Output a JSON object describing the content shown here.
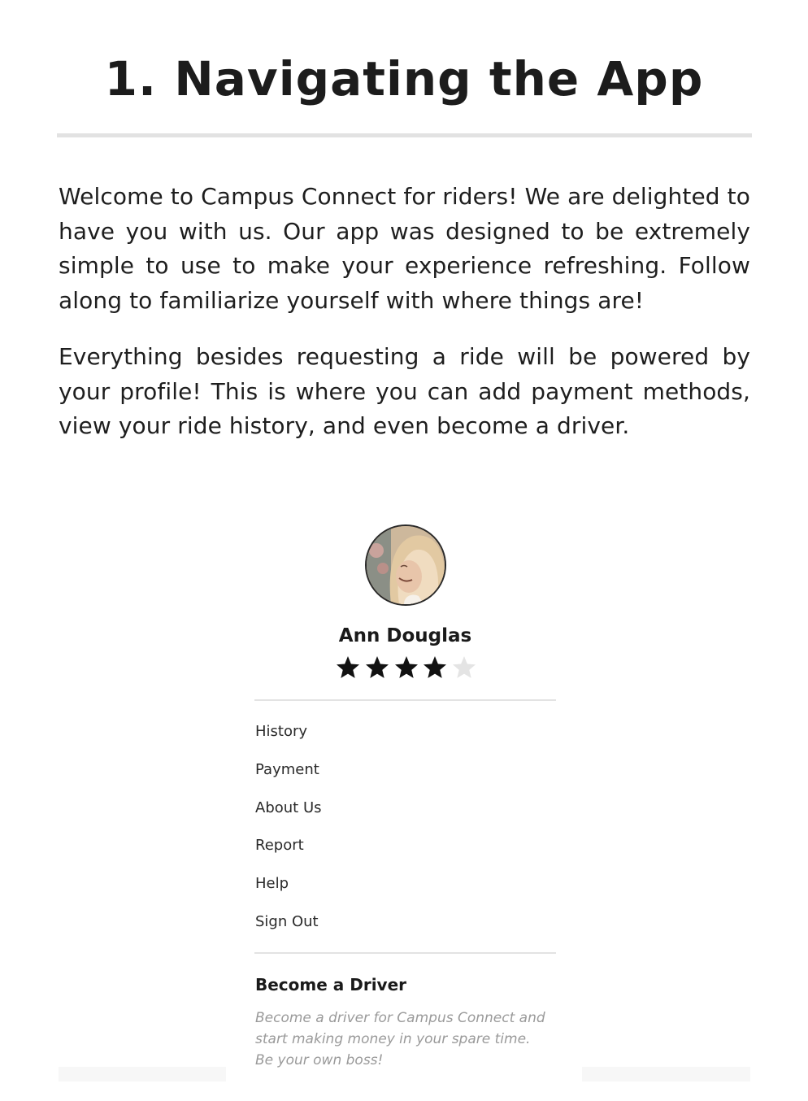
{
  "page": {
    "title": "1. Navigating the App",
    "paragraphs": [
      "Welcome to Campus Connect for riders! We are delighted to have you with us. Our app was designed to be extremely simple to use to make your experience refreshing. Follow along to familiarize yourself with where things are!",
      "Everything besides requesting a ride will be powered by your profile! This is where you can add payment methods, view your ride history, and even become a driver."
    ]
  },
  "profile": {
    "name": "Ann Douglas",
    "rating": 4,
    "rating_max": 5,
    "star_color": "#111111",
    "star_empty_color": "#e4e4e4",
    "menu": [
      {
        "label": "History"
      },
      {
        "label": "Payment"
      },
      {
        "label": "About Us"
      },
      {
        "label": "Report"
      },
      {
        "label": "Help"
      },
      {
        "label": "Sign Out"
      }
    ],
    "become_driver": {
      "title": "Become a Driver",
      "description": "Become a driver for Campus Connect and start making money in your spare time. Be your own boss!"
    }
  }
}
